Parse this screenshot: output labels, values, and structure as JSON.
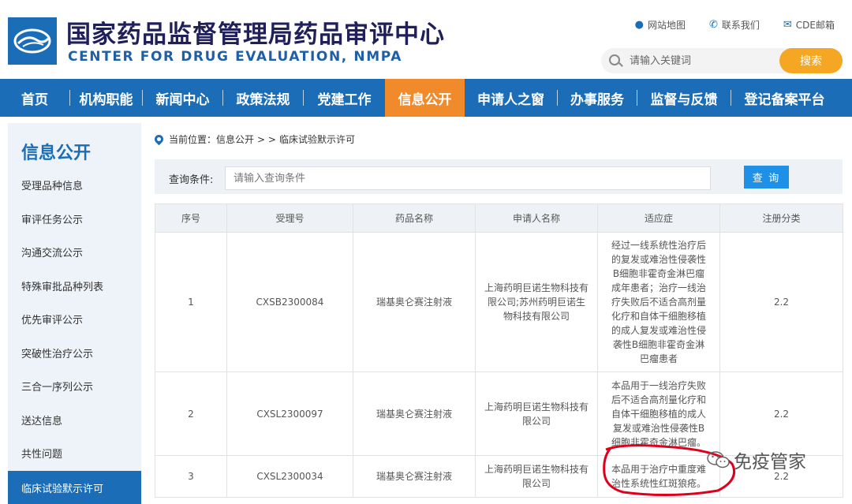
{
  "header": {
    "title_cn": "国家药品监督管理局药品审评中心",
    "title_en": "CENTER FOR DRUG EVALUATION, NMPA",
    "toplinks": [
      "网站地图",
      "联系我们",
      "CDE邮箱"
    ],
    "search_placeholder": "请输入关键词",
    "search_button": "搜索"
  },
  "nav": {
    "items": [
      "首页",
      "机构职能",
      "新闻中心",
      "政策法规",
      "党建工作",
      "信息公开",
      "申请人之窗",
      "办事服务",
      "监督与反馈",
      "登记备案平台"
    ],
    "active": "信息公开"
  },
  "sidebar": {
    "title": "信息公开",
    "items": [
      "受理品种信息",
      "审评任务公示",
      "沟通交流公示",
      "特殊审批品种列表",
      "优先审评公示",
      "突破性治疗公示",
      "三合一序列公示",
      "送达信息",
      "共性问题",
      "临床试验默示许可"
    ],
    "active": "临床试验默示许可"
  },
  "breadcrumb": {
    "prefix": "当前位置：信息公开",
    "sep": "> >",
    "current": "临床试验默示许可"
  },
  "query": {
    "label": "查询条件:",
    "placeholder": "请输入查询条件",
    "button": "查 询"
  },
  "table": {
    "headers": [
      "序号",
      "受理号",
      "药品名称",
      "申请人名称",
      "适应症",
      "注册分类"
    ],
    "rows": [
      [
        "1",
        "CXSB2300084",
        "瑞基奥仑赛注射液",
        "上海药明巨诺生物科技有限公司;苏州药明巨诺生物科技有限公司",
        "经过一线系统性治疗后的复发或难治性侵袭性B细胞非霍奇金淋巴瘤成年患者；治疗一线治疗失败后不适合高剂量化疗和自体干细胞移植的成人复发或难治性侵袭性B细胞非霍奇金淋巴瘤患者",
        "2.2"
      ],
      [
        "2",
        "CXSL2300097",
        "瑞基奥仑赛注射液",
        "上海药明巨诺生物科技有限公司",
        "本品用于一线治疗失败后不适合高剂量化疗和自体干细胞移植的成人复发或难治性侵袭性B细胞非霍奇金淋巴瘤。",
        "2.2"
      ],
      [
        "3",
        "CXSL2300034",
        "瑞基奥仑赛注射液",
        "上海药明巨诺生物科技有限公司",
        "本品用于治疗中重度难治性系统性红斑狼疮。",
        "2.2"
      ]
    ]
  },
  "watermark": "免疫管家",
  "colors": {
    "primary": "#1a6db6",
    "accent": "#f08a2a",
    "search": "#f5a623",
    "query_button": "#1e90e8",
    "annotation": "#e0001b"
  }
}
